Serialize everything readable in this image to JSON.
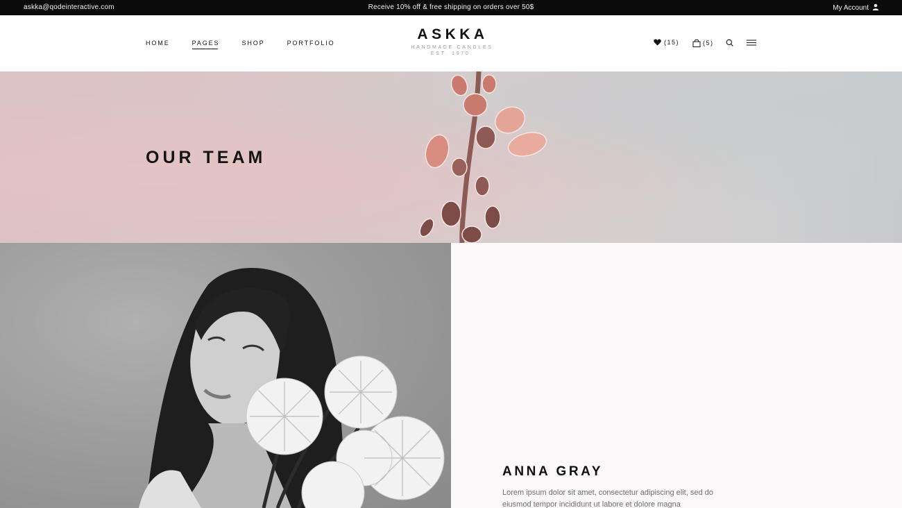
{
  "topbar": {
    "email": "askka@qodeinteractive.com",
    "promo": "Receive 10% off & free shipping on orders over 50$",
    "account_label": "My Account"
  },
  "nav": {
    "items": [
      {
        "label": "HOME"
      },
      {
        "label": "PAGES"
      },
      {
        "label": "SHOP"
      },
      {
        "label": "PORTFOLIO"
      }
    ],
    "active": "PAGES"
  },
  "logo": {
    "brand": "ASKKA",
    "tagline": "HANDMADE CANDLES",
    "established": "EST. 1970."
  },
  "header_icons": {
    "wishlist_count": "(15)",
    "cart_count": "(5)",
    "icons": [
      "heart-icon",
      "bag-icon",
      "search-icon",
      "hamburger-menu-icon"
    ]
  },
  "hero": {
    "title": "OUR TEAM"
  },
  "member": {
    "name": "ANNA GRAY",
    "bio": "Lorem ipsum dolor sit amet, consectetur adipiscing elit, sed do eiusmod tempor incididunt ut labore et dolore magna"
  },
  "colors": {
    "topbar_bg": "#0b0b0b",
    "hero_bg": "#dcc6c8",
    "info_bg": "#fbf9f9",
    "flower": "#d98f82"
  }
}
